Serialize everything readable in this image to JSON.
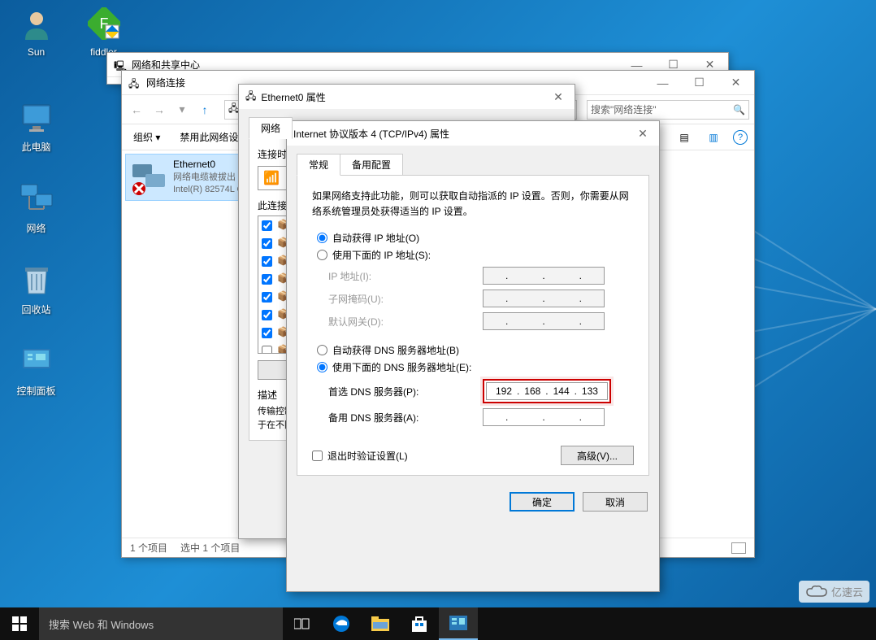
{
  "desktop": {
    "icons": [
      {
        "label": "Sun",
        "name": "desktop-user-sun"
      },
      {
        "label": "fiddler",
        "name": "desktop-app-fiddler"
      },
      {
        "label": "此电脑",
        "name": "desktop-this-pc"
      },
      {
        "label": "网络",
        "name": "desktop-network"
      },
      {
        "label": "回收站",
        "name": "desktop-recycle-bin"
      },
      {
        "label": "控制面板",
        "name": "desktop-control-panel"
      }
    ]
  },
  "win_nscenter": {
    "title": "网络和共享中心"
  },
  "win_netconn": {
    "title": "网络连接",
    "search_placeholder": "搜索\"网络连接\"",
    "toolbar": {
      "organize": "组织 ▾",
      "disable": "禁用此网络设备"
    },
    "adapter": {
      "name": "Ethernet0",
      "status": "网络电缆被拔出",
      "device": "Intel(R) 82574L Gigabit Network Connection"
    },
    "status": {
      "count": "1 个项目",
      "selected": "选中 1 个项目"
    }
  },
  "dlg_ethprops": {
    "title": "Ethernet0 属性",
    "tab": "网络",
    "connect_using": "连接时使用:",
    "items_label": "此连接使用下列项目(O):",
    "desc_label": "描述",
    "desc_text1": "传输控制协议/Internet协议。该协议是默认",
    "desc_text2": "于在不同的相互连接的网络上通信。"
  },
  "dlg_ipv4": {
    "title": "Internet 协议版本 4 (TCP/IPv4) 属性",
    "tabs": {
      "general": "常规",
      "alt": "备用配置"
    },
    "desc": "如果网络支持此功能，则可以获取自动指派的 IP 设置。否则，你需要从网络系统管理员处获得适当的 IP 设置。",
    "radio_auto_ip": "自动获得 IP 地址(O)",
    "radio_manual_ip": "使用下面的 IP 地址(S):",
    "label_ip": "IP 地址(I):",
    "label_mask": "子网掩码(U):",
    "label_gateway": "默认网关(D):",
    "radio_auto_dns": "自动获得 DNS 服务器地址(B)",
    "radio_manual_dns": "使用下面的 DNS 服务器地址(E):",
    "label_dns1": "首选 DNS 服务器(P):",
    "label_dns2": "备用 DNS 服务器(A):",
    "dns1": {
      "o1": "192",
      "o2": "168",
      "o3": "144",
      "o4": "133"
    },
    "chk_validate": "退出时验证设置(L)",
    "btn_advanced": "高级(V)...",
    "btn_ok": "确定",
    "btn_cancel": "取消"
  },
  "taskbar": {
    "search": "搜索 Web 和 Windows"
  },
  "watermark": "亿速云"
}
